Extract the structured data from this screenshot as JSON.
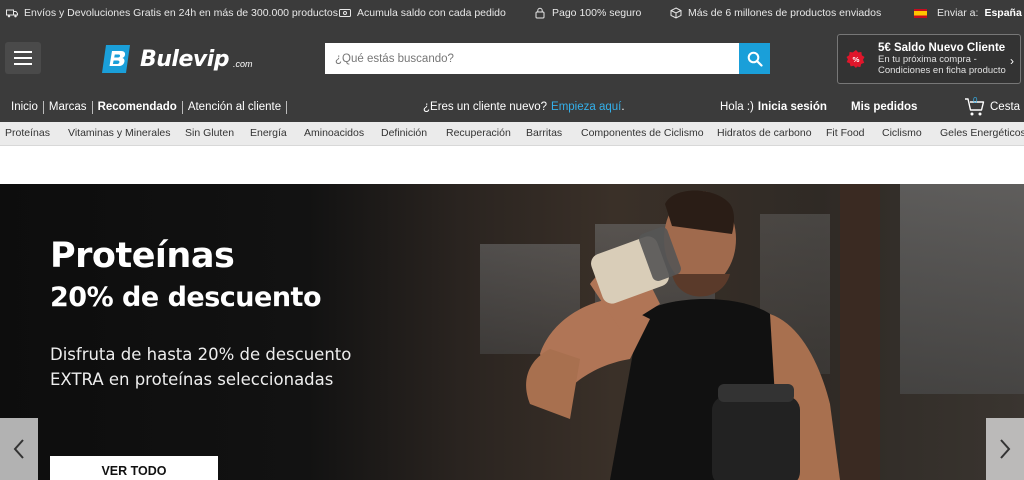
{
  "infobar": {
    "shipping_returns": "Envíos y Devoluciones Gratis en 24h en más de 300.000 productos",
    "balance": "Acumula saldo con cada pedido",
    "secure_payment": "Pago 100% seguro",
    "products_sent": "Más de 6 millones de productos enviados",
    "ship_to_label": "Enviar a:",
    "ship_to_country": "España"
  },
  "header": {
    "logo_text": "Bulevip",
    "logo_suffix": ".com",
    "search_placeholder": "¿Qué estás buscando?",
    "promo_title": "5€ Saldo Nuevo Cliente",
    "promo_line1": "En tu próxima compra -",
    "promo_line2": "Condiciones en ficha producto"
  },
  "nav": {
    "links": [
      "Inicio",
      "Marcas",
      "Recomendado",
      "Atención al cliente"
    ],
    "new_customer_q": "¿Eres un cliente nuevo?",
    "new_customer_link": "Empieza aquí",
    "new_customer_dot": ".",
    "greeting": "Hola :)",
    "login": "Inicia sesión",
    "orders": "Mis pedidos",
    "cart_label": "Cesta",
    "cart_count": "0"
  },
  "categories": [
    "Proteínas",
    "Vitaminas y Minerales",
    "Sin Gluten",
    "Energía",
    "Aminoacidos",
    "Definición",
    "Recuperación",
    "Barritas",
    "Componentes de Ciclismo",
    "Hidratos de carbono",
    "Fit Food",
    "Ciclismo",
    "Geles Energéticos"
  ],
  "hero": {
    "title": "Proteínas",
    "subtitle": "20% de descuento",
    "desc_line1": "Disfruta de hasta 20% de descuento",
    "desc_line2": "EXTRA en proteínas seleccionadas",
    "cta": "VER TODO"
  },
  "colors": {
    "bar_bg": "#3b3b3b",
    "accent": "#1a9fd9",
    "link": "#34b0ea"
  }
}
